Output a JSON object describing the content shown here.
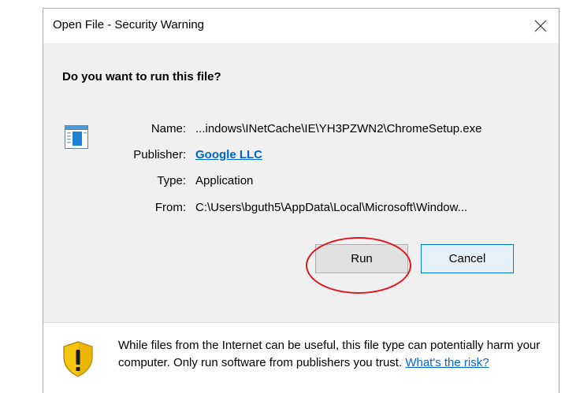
{
  "window": {
    "title": "Open File - Security Warning",
    "close_glyph": "✕"
  },
  "prompt": {
    "question": "Do you want to run this file?"
  },
  "file_icon": "executable-file-icon",
  "details": {
    "name_label": "Name:",
    "name_value": "...indows\\INetCache\\IE\\YH3PZWN2\\ChromeSetup.exe",
    "publisher_label": "Publisher:",
    "publisher_value": "Google LLC",
    "type_label": "Type:",
    "type_value": "Application",
    "from_label": "From:",
    "from_value": "C:\\Users\\bguth5\\AppData\\Local\\Microsoft\\Window..."
  },
  "buttons": {
    "run_label": "Run",
    "cancel_label": "Cancel"
  },
  "annotation": {
    "highlight_color": "#e0161c",
    "target": "Run"
  },
  "footer": {
    "icon": "shield-warning-icon",
    "warning_text": "While files from the Internet can be useful, this file type can potentially harm your computer. Only run software from publishers you trust.",
    "risk_link": "What's the risk?"
  },
  "colors": {
    "link": "#0066cc",
    "body_bg": "#f0f0f0",
    "cancel_border": "#0078d7",
    "shield_yellow": "#f6c50f"
  }
}
